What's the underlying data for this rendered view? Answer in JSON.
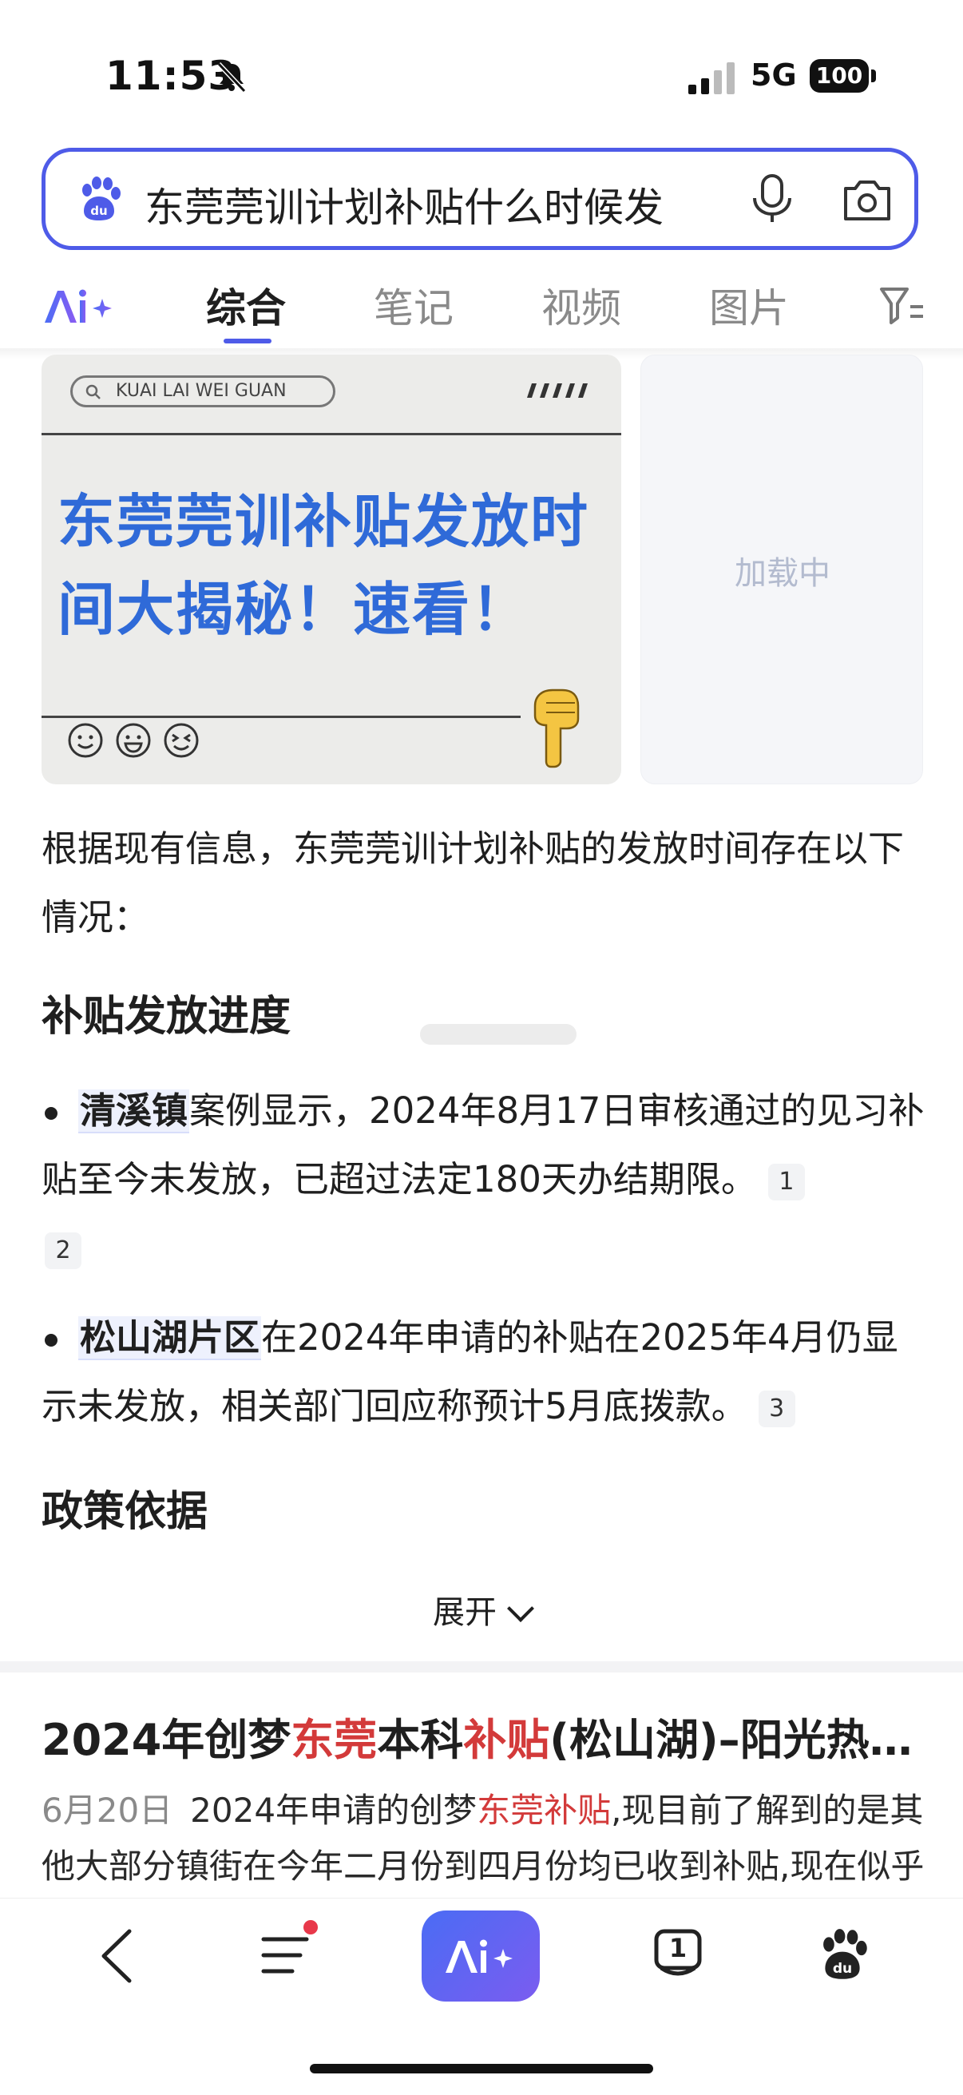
{
  "status_bar": {
    "time": "11:53",
    "network": "5G",
    "battery": "100",
    "icons": [
      "bell-muted-icon",
      "signal-icon",
      "battery-icon"
    ]
  },
  "search": {
    "query": "东莞莞训计划补贴什么时候发",
    "icons": [
      "baidu-paw-icon",
      "microphone-icon",
      "camera-icon"
    ]
  },
  "tabs": {
    "ai_label": "Ai+",
    "items": [
      "综合",
      "笔记",
      "视频",
      "图片"
    ],
    "active": "综合"
  },
  "image_card": {
    "pill_text": "KUAI LAI WEI GUAN",
    "headline": "东莞莞训补贴发放时间大揭秘！速看！",
    "loading_text": "加载中"
  },
  "answer": {
    "intro": "根据现有信息，东莞莞训计划补贴的发放时间存在以下情况：",
    "section1_title": "补贴发放进度",
    "bullet1_highlight": "清溪镇",
    "bullet1_text": "案例显示，2024年8月17日审核通过的见习补贴至今未发放，已超过法定180天办结期限。",
    "bullet1_cites": [
      "1",
      "2"
    ],
    "bullet2_highlight": "松山湖片区",
    "bullet2_text": "在2024年申请的补贴在2025年4月仍显示未发放，相关部门回应称预计5月底拨款。",
    "bullet2_cites": [
      "3"
    ],
    "section2_title": "政策依据",
    "expand_label": "展开"
  },
  "result": {
    "title_parts": [
      "2024年创梦",
      "东莞",
      "本科",
      "补贴",
      "(松山湖)–阳光热…"
    ],
    "date": "6月20日",
    "snippet_parts": [
      "2024年申请的创梦",
      "东莞补贴",
      ",现目前了解到的是其他大部分镇街在今年二月份到四月份均已收到补贴,现在似乎"
    ]
  },
  "bottom_nav": {
    "ai_label": "Ai+",
    "tab_count": "1",
    "colors": {
      "accent": "#4e5be8",
      "badge": "#e8384a",
      "highlight_red": "#d33a3a"
    }
  }
}
